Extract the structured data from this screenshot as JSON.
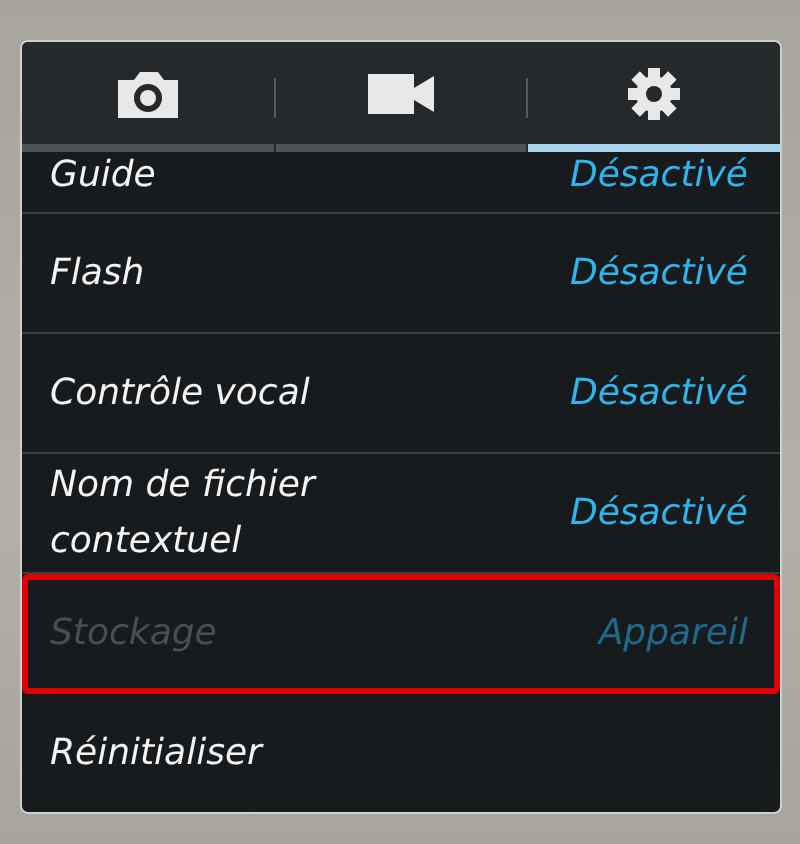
{
  "tabs": [
    {
      "kind": "camera",
      "selected": false
    },
    {
      "kind": "video",
      "selected": false
    },
    {
      "kind": "settings",
      "selected": true
    }
  ],
  "settings": [
    {
      "label": "Guide",
      "value": "Désactivé",
      "disabled": false,
      "highlighted": false
    },
    {
      "label": "Flash",
      "value": "Désactivé",
      "disabled": false,
      "highlighted": false
    },
    {
      "label": "Contrôle vocal",
      "value": "Désactivé",
      "disabled": false,
      "highlighted": false
    },
    {
      "label": "Nom de fichier contextuel",
      "value": "Désactivé",
      "disabled": false,
      "highlighted": false
    },
    {
      "label": "Stockage",
      "value": "Appareil",
      "disabled": true,
      "highlighted": true
    },
    {
      "label": "Réinitialiser",
      "disabled": false,
      "highlighted": false
    }
  ]
}
